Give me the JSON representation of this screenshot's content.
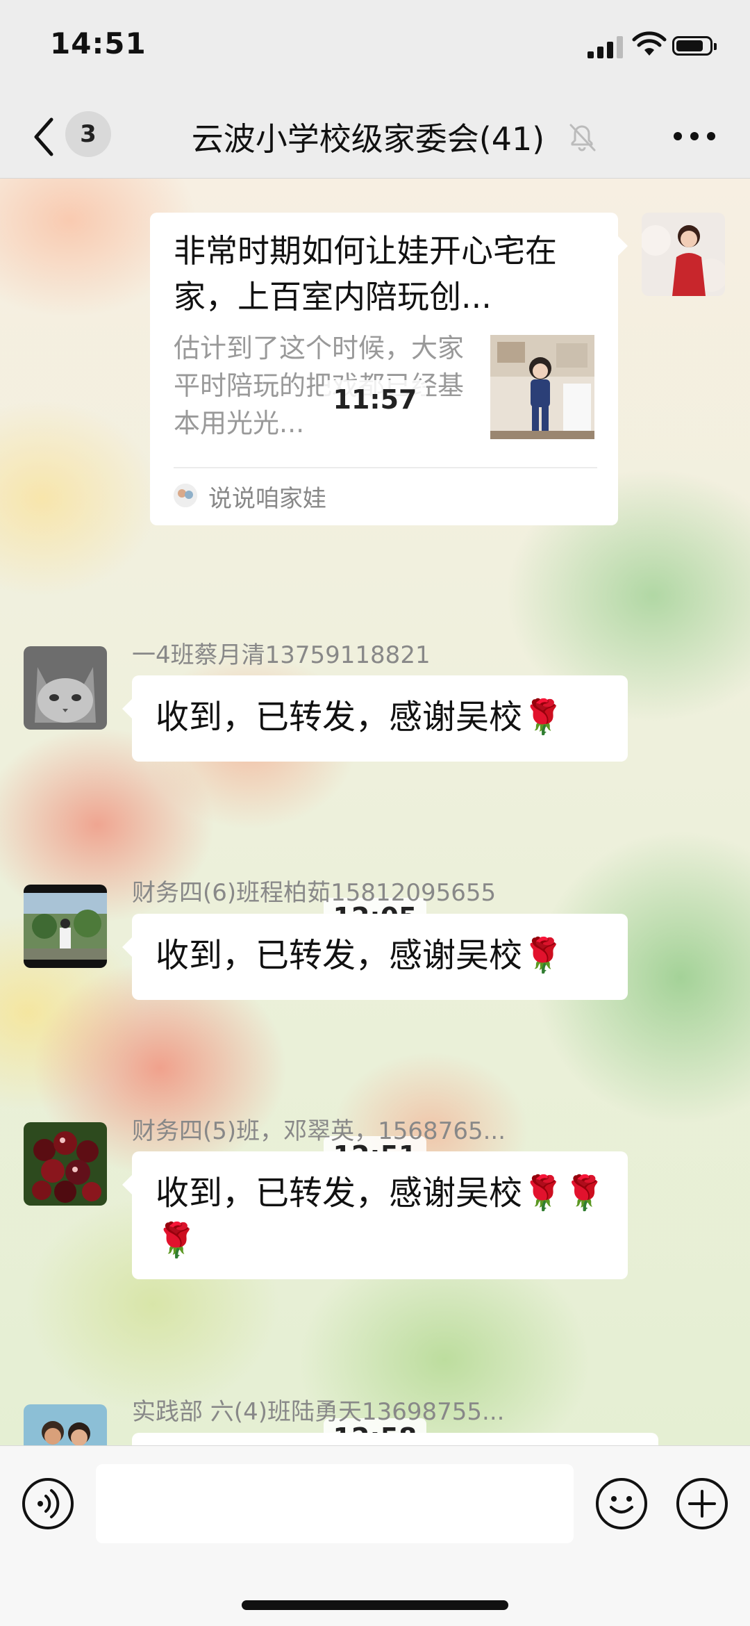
{
  "status": {
    "time": "14:51"
  },
  "nav": {
    "unread_badge": "3",
    "title": "云波小学校级家委会(41)"
  },
  "card": {
    "title": "非常时期如何让娃开心宅在家，上百室内陪玩创...",
    "description": "估计到了这个时候，大家平时陪玩的把戏都已经基本用光光...",
    "source": "说说咱家娃"
  },
  "messages": [
    {
      "timestamp": "11:57",
      "sender": "一4班蔡月清13759118821",
      "text": "收到，已转发，感谢吴校🌹"
    },
    {
      "timestamp": "12:05",
      "sender": "财务四(6)班程柏茹15812095655",
      "text": "收到，已转发，感谢吴校🌹"
    },
    {
      "timestamp": "12:51",
      "sender": "财务四(5)班，邓翠英，1568765...",
      "text": "收到，已转发，感谢吴校🌹🌹🌹"
    },
    {
      "timestamp": "12:58",
      "sender": "实践部  六(4)班陆勇天13698755...",
      "text": ""
    }
  ],
  "input": {
    "value": ""
  }
}
